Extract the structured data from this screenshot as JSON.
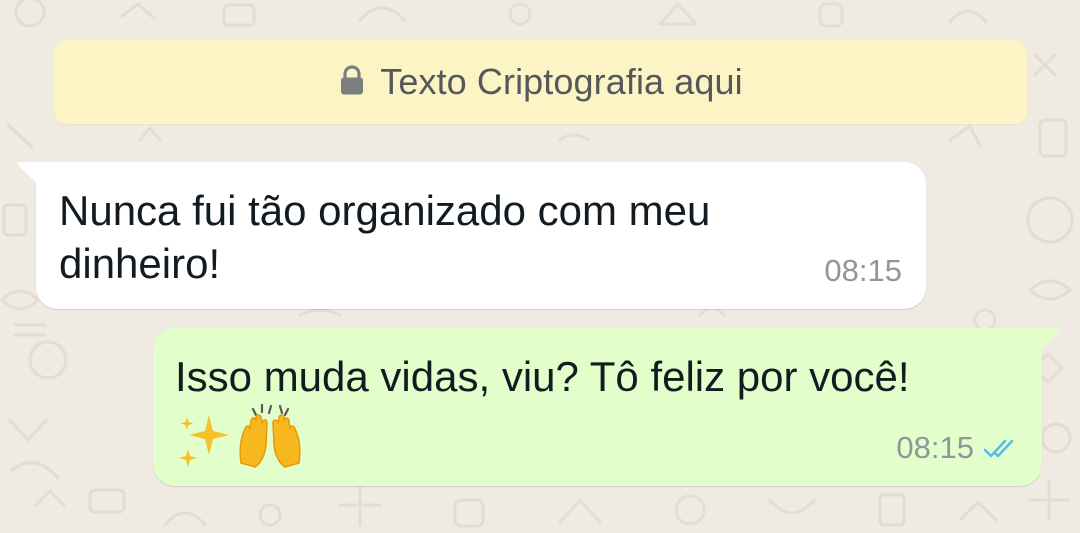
{
  "encryption_banner": {
    "icon": "lock-icon",
    "text": "Texto Criptografia aqui"
  },
  "messages": [
    {
      "direction": "incoming",
      "text": "Nunca fui tão organizado com meu dinheiro!",
      "time": "08:15"
    },
    {
      "direction": "outgoing",
      "text": "Isso muda vidas, viu? Tô feliz por você!",
      "emojis": [
        {
          "name": "sparkles-emoji",
          "char": "✨"
        },
        {
          "name": "raising-hands-emoji",
          "char": "🙌"
        }
      ],
      "time": "08:15",
      "status_icon": "double-check-icon",
      "status_color": "#53bdeb"
    }
  ],
  "colors": {
    "chat_background": "#efeae2",
    "banner_background": "#fdf4c5",
    "incoming_bubble": "#ffffff",
    "outgoing_bubble": "#e2fecb",
    "read_receipt": "#53bdeb"
  }
}
